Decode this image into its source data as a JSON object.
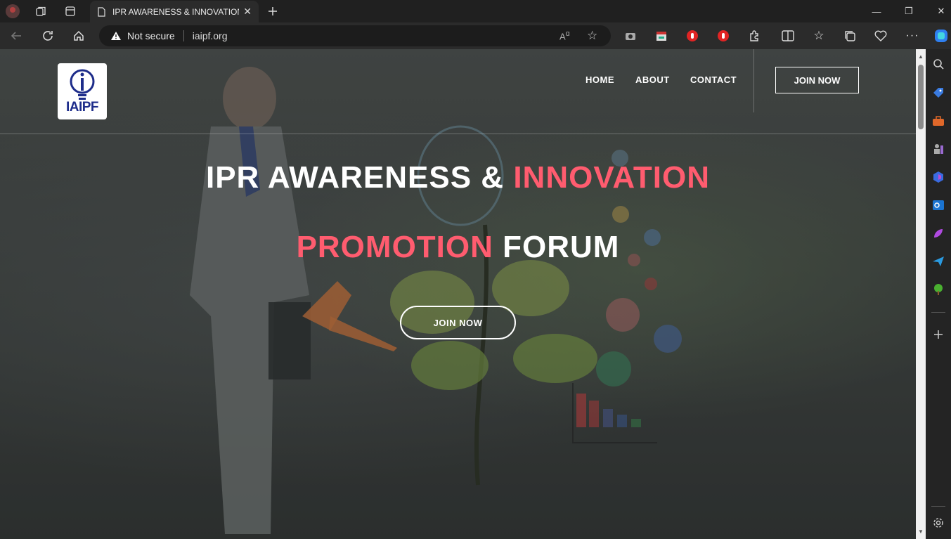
{
  "browser": {
    "tab_title": "IPR AWARENESS & INNOVATION",
    "security_label": "Not secure",
    "url": "iaipf.org"
  },
  "site": {
    "logo_text": "IAIPF",
    "nav": [
      "HOME",
      "ABOUT",
      "CONTACT"
    ],
    "header_button": "JOIN NOW",
    "hero": {
      "line1_white": "IPR AWARENESS & ",
      "line1_accent": "INNOVATION",
      "line2_accent": "PROMOTION",
      "line2_white": " FORUM",
      "button": "JOIN NOW"
    },
    "accent_color": "#ff5c6f"
  },
  "sidebar_icons": [
    "search-icon",
    "tag-icon",
    "toolbox-icon",
    "chess-icon",
    "copilot-icon",
    "outlook-icon",
    "designer-icon",
    "send-icon",
    "tree-icon",
    "add-icon",
    "settings-icon"
  ]
}
